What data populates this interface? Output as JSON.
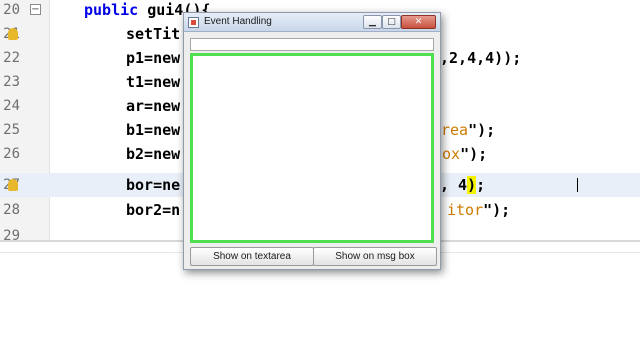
{
  "editor": {
    "lines": [
      {
        "num": "20",
        "code": {
          "kw": "public ",
          "text": "gui4(){"
        }
      },
      {
        "num": "21",
        "code": {
          "text": "setTit"
        }
      },
      {
        "num": "22",
        "code": {
          "text": "p1=new",
          "tail": ",2,4,4));"
        }
      },
      {
        "num": "23",
        "code": {
          "text": "t1=new"
        }
      },
      {
        "num": "24",
        "code": {
          "text": "ar=new"
        }
      },
      {
        "num": "25",
        "code": {
          "text": "b1=new",
          "str": "rea",
          "tail": "\");"
        }
      },
      {
        "num": "26",
        "code": {
          "text": "b2=new",
          "str": "ox",
          "tail": "\");"
        }
      },
      {
        "num": "27",
        "code": {
          "text": "bor=ne",
          "tail": ", 4",
          "hl": ")",
          "end": ";"
        }
      },
      {
        "num": "28",
        "code": {
          "text": "bor2=n",
          "str": "itor",
          "tail": "\");"
        }
      },
      {
        "num": "29",
        "code": {
          "text": ""
        }
      }
    ]
  },
  "window": {
    "title": "Event Handling",
    "min_glyph": "▁",
    "max_glyph": "□",
    "close_glyph": "✕",
    "buttons": [
      "Show on textarea",
      "Show on msg box"
    ]
  },
  "colors": {
    "textarea_border": "#4fe04f",
    "keyword": "#0000e6",
    "string": "#ce7b00",
    "bracket_highlight": "#f3f300"
  },
  "icons": [
    "warning-marker-icon",
    "fold-toggle-icon",
    "app-icon",
    "minimize-icon",
    "maximize-icon",
    "close-icon"
  ]
}
